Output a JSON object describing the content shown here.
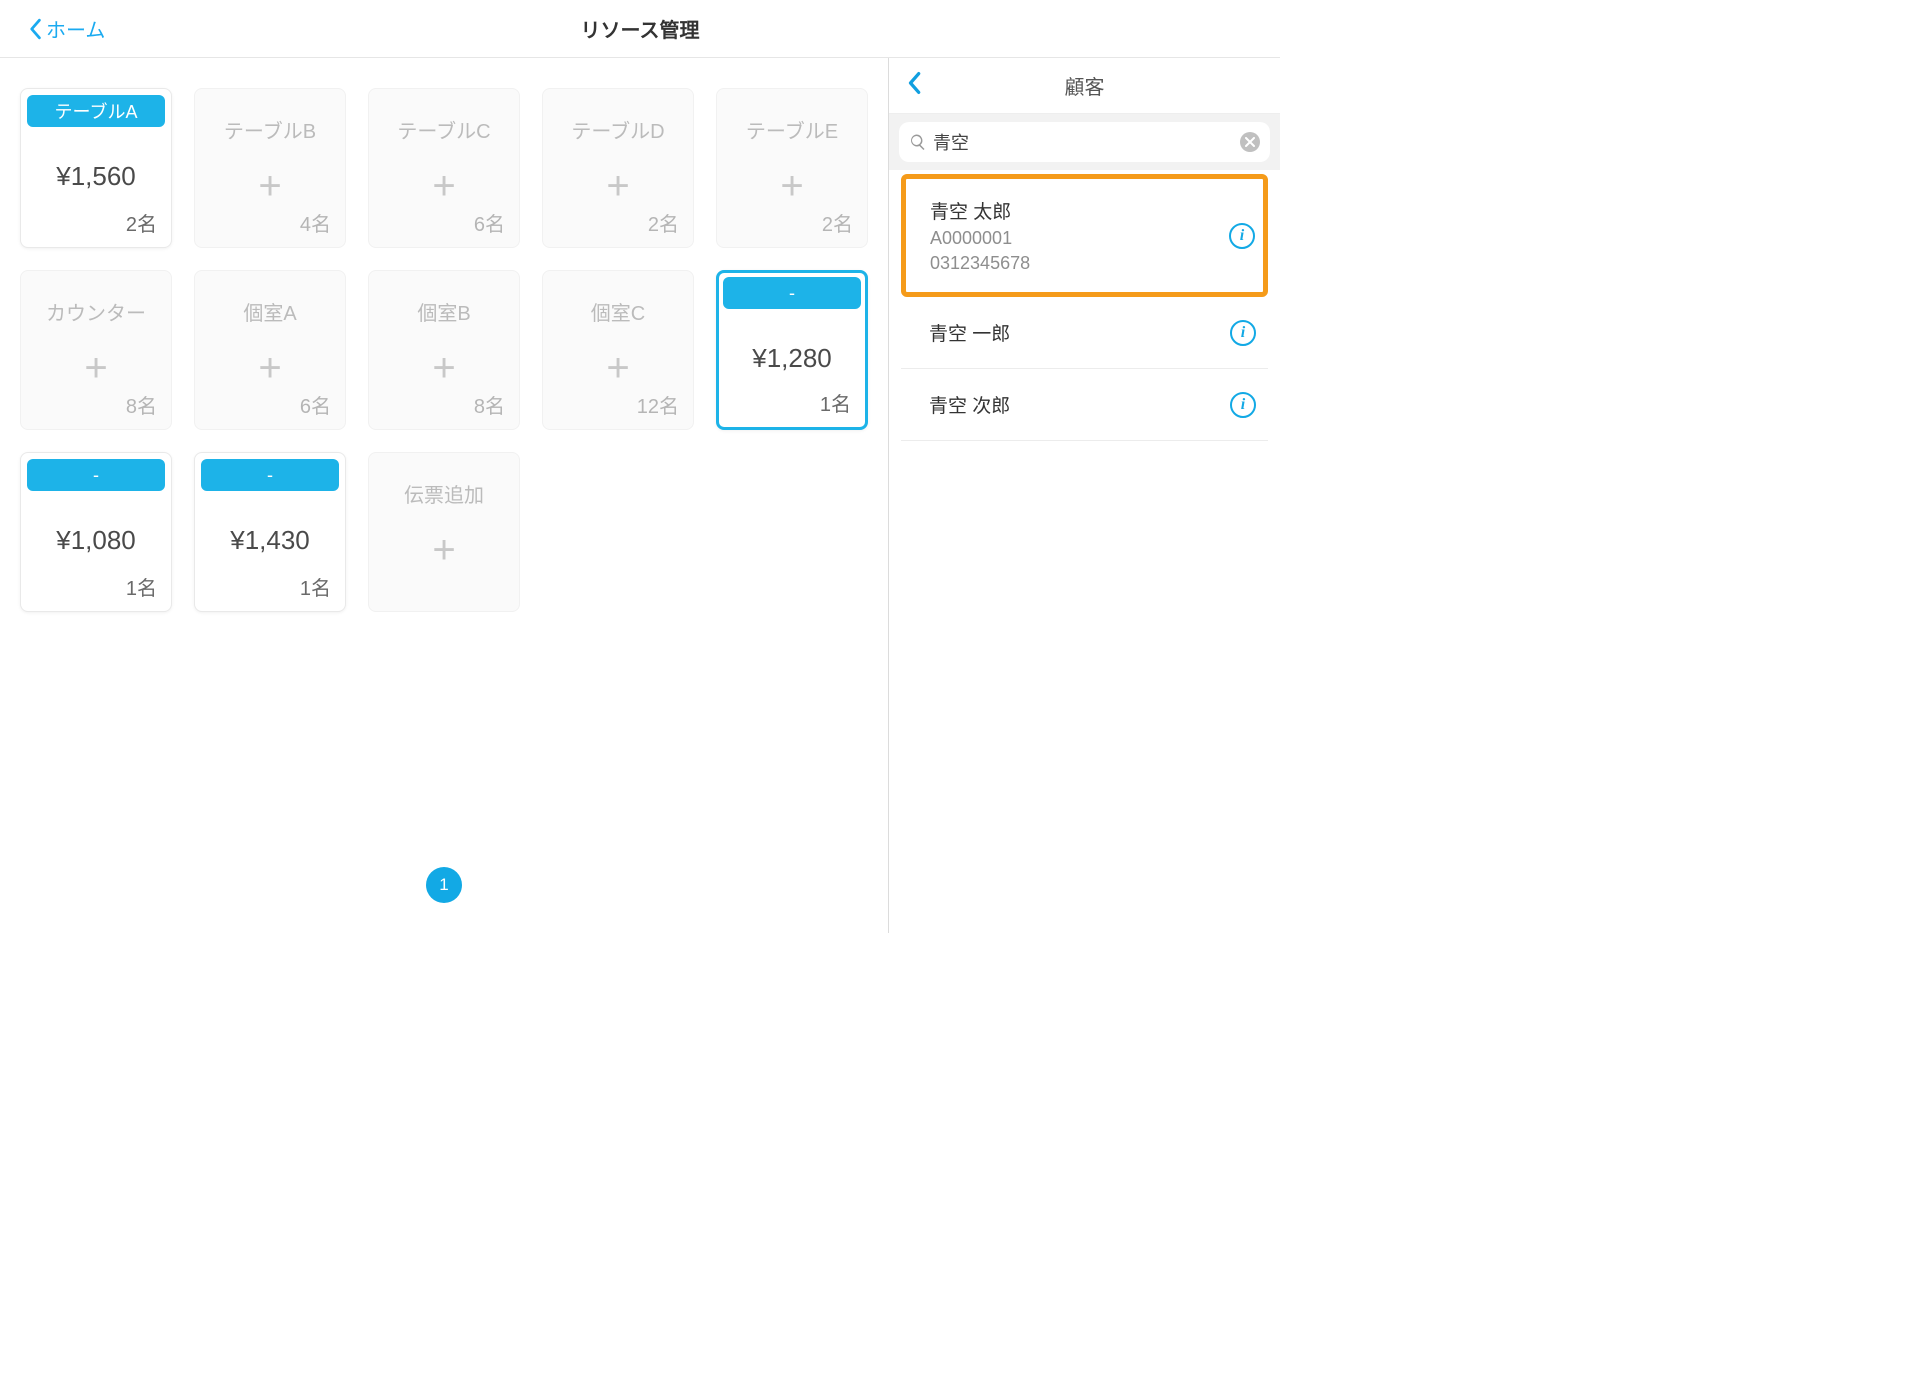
{
  "header": {
    "back_label": "ホーム",
    "title": "リソース管理"
  },
  "resources": [
    {
      "name": "テーブルA",
      "state": "active",
      "amount": "¥1,560",
      "capacity": "2名"
    },
    {
      "name": "テーブルB",
      "state": "empty",
      "capacity": "4名"
    },
    {
      "name": "テーブルC",
      "state": "empty",
      "capacity": "6名"
    },
    {
      "name": "テーブルD",
      "state": "empty",
      "capacity": "2名"
    },
    {
      "name": "テーブルE",
      "state": "empty",
      "capacity": "2名"
    },
    {
      "name": "カウンター",
      "state": "empty",
      "capacity": "8名"
    },
    {
      "name": "個室A",
      "state": "empty",
      "capacity": "6名"
    },
    {
      "name": "個室B",
      "state": "empty",
      "capacity": "8名"
    },
    {
      "name": "個室C",
      "state": "empty",
      "capacity": "12名"
    },
    {
      "name": "-",
      "state": "active-selected",
      "amount": "¥1,280",
      "capacity": "1名"
    },
    {
      "name": "-",
      "state": "active",
      "amount": "¥1,080",
      "capacity": "1名"
    },
    {
      "name": "-",
      "state": "active",
      "amount": "¥1,430",
      "capacity": "1名"
    },
    {
      "name": "伝票追加",
      "state": "add-slip"
    }
  ],
  "pagination": {
    "current": "1"
  },
  "sidebar": {
    "title": "顧客",
    "search_value": "青空",
    "customers": [
      {
        "name": "青空 太郎",
        "code": "A0000001",
        "phone": "0312345678",
        "highlighted": true
      },
      {
        "name": "青空 一郎"
      },
      {
        "name": "青空 次郎"
      }
    ]
  }
}
